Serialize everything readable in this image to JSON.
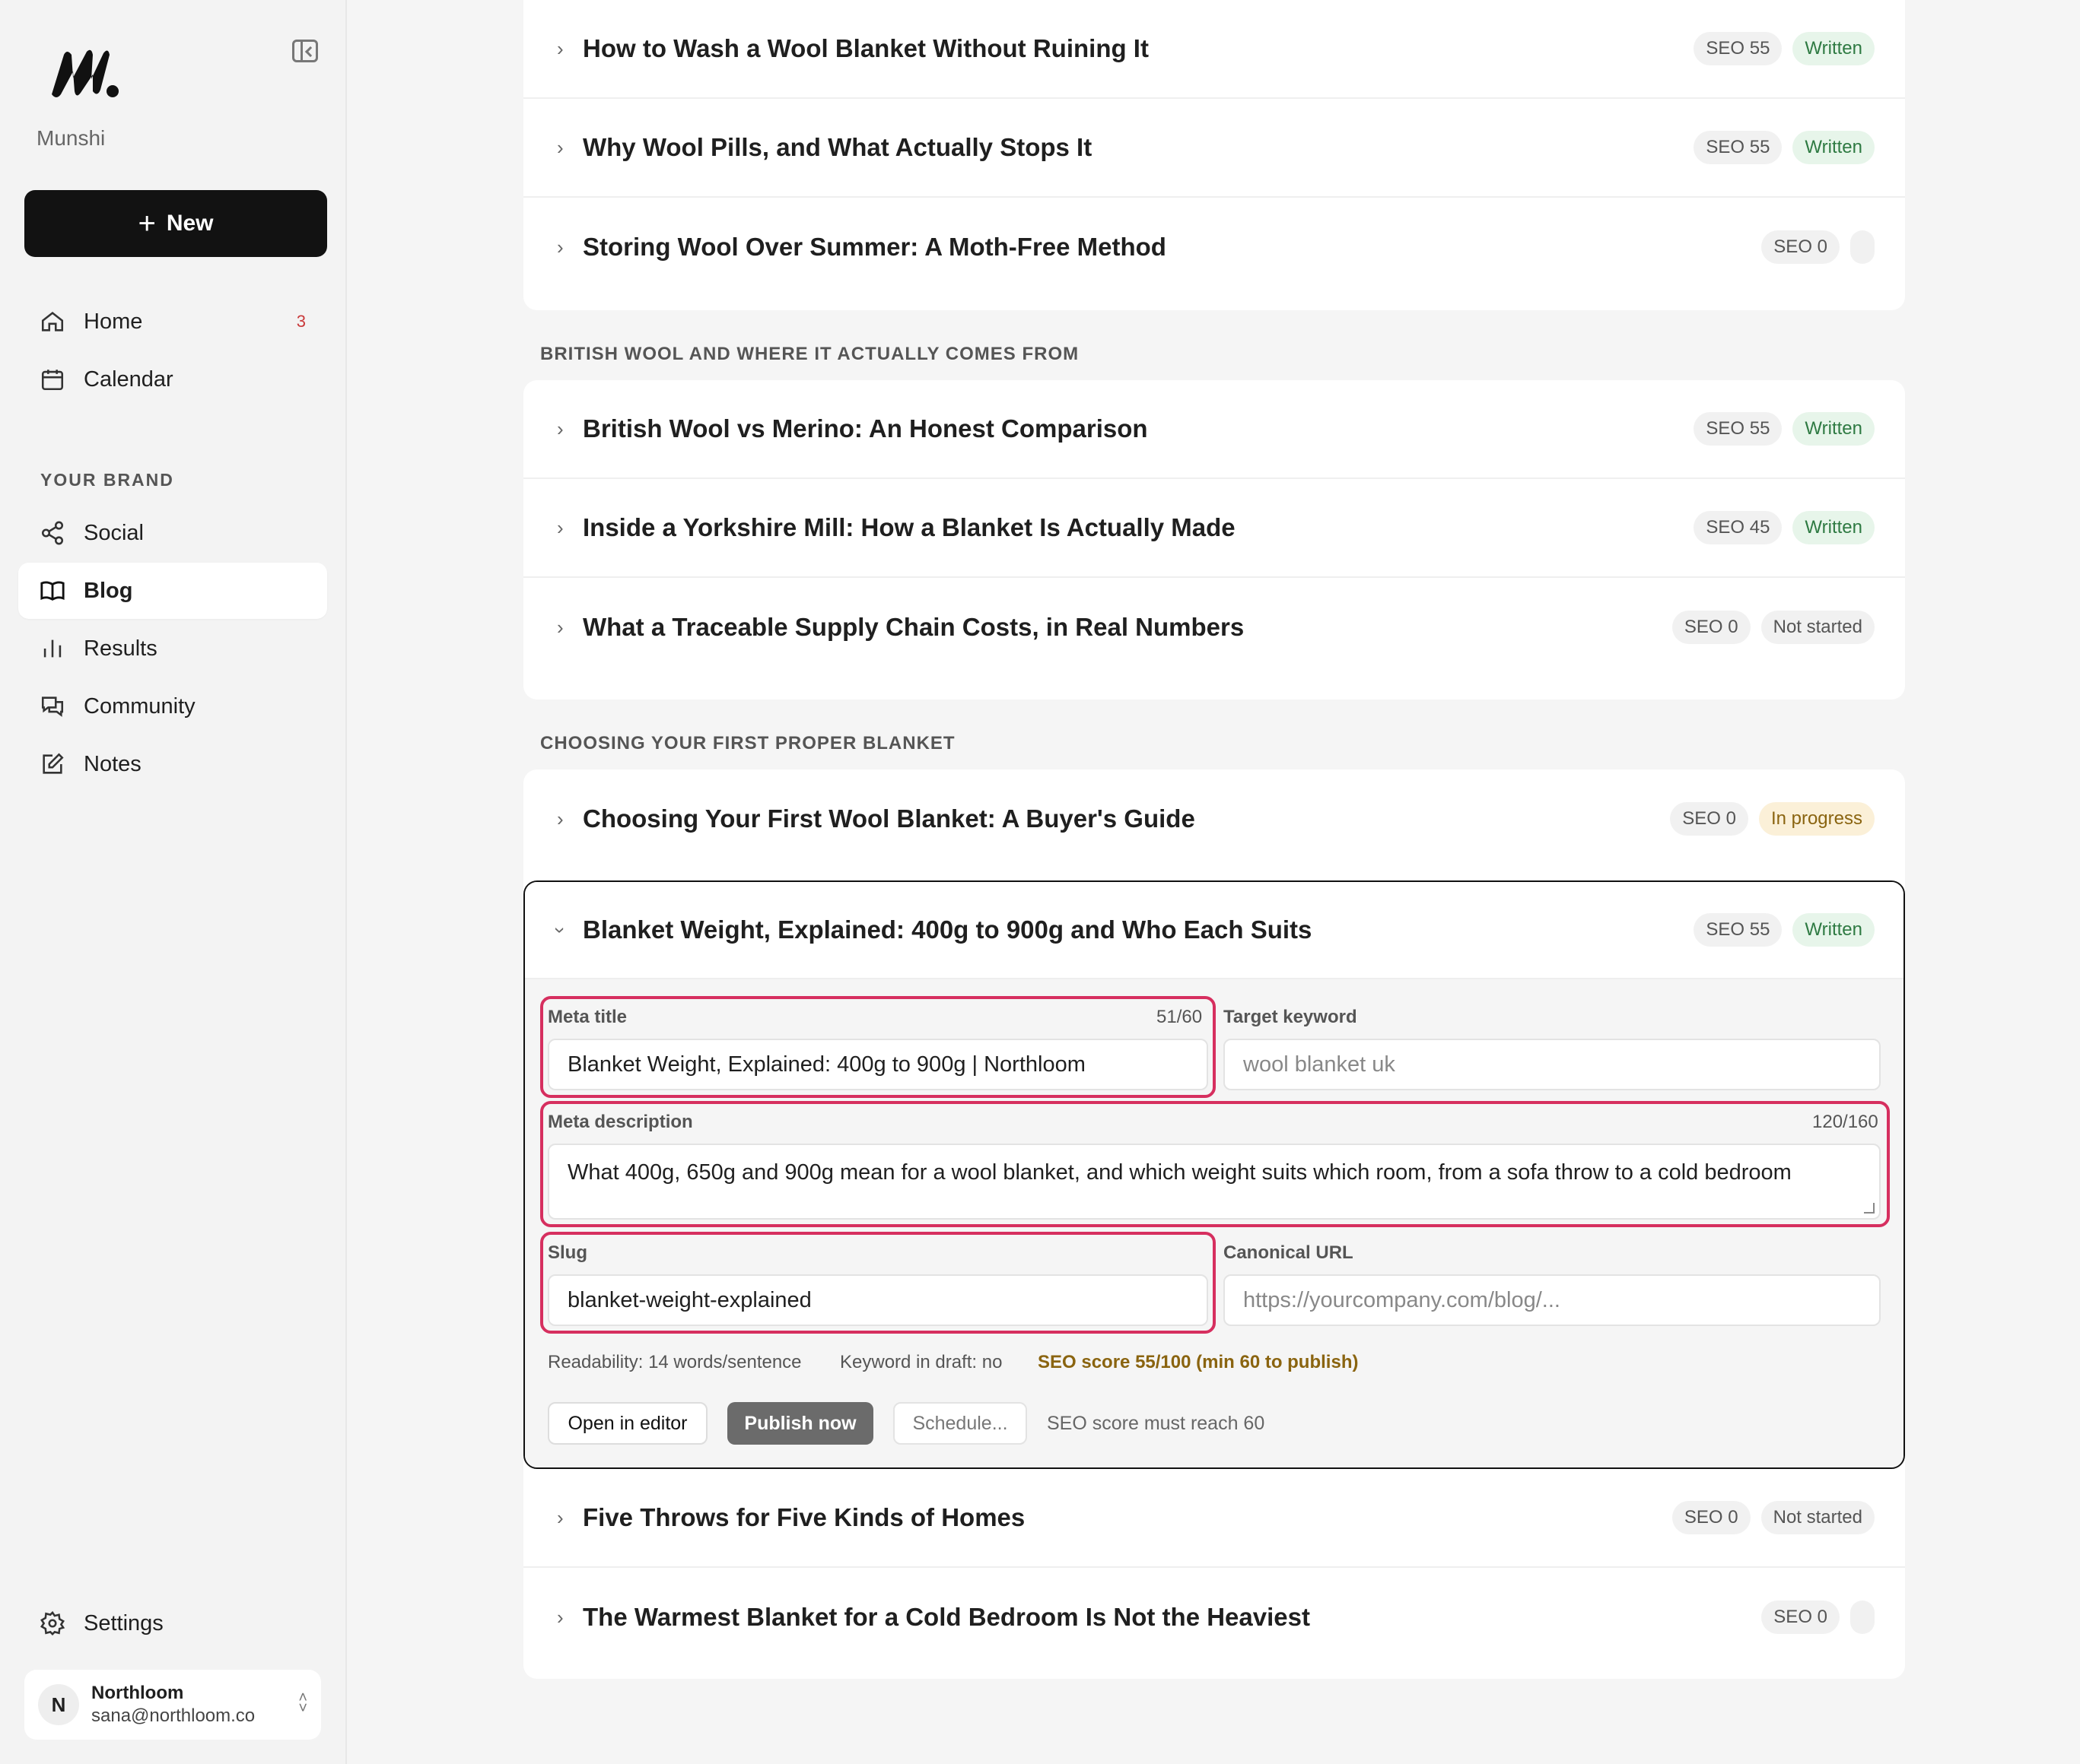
{
  "sidebar": {
    "brand": "Munshi",
    "new_label": "New",
    "nav": [
      {
        "label": "Home",
        "badge": "3"
      },
      {
        "label": "Calendar"
      }
    ],
    "section_label": "YOUR BRAND",
    "brand_nav": [
      {
        "label": "Social"
      },
      {
        "label": "Blog"
      },
      {
        "label": "Results"
      },
      {
        "label": "Community"
      },
      {
        "label": "Notes"
      }
    ],
    "settings_label": "Settings",
    "account": {
      "initial": "N",
      "name": "Northloom",
      "email": "sana@northloom.co"
    }
  },
  "groups": [
    {
      "label": "",
      "posts": [
        {
          "title": "How to Wash a Wool Blanket Without Ruining It",
          "seo": "SEO 55",
          "status": "Written"
        },
        {
          "title": "Why Wool Pills, and What Actually Stops It",
          "seo": "SEO 55",
          "status": "Written"
        },
        {
          "title": "Storing Wool Over Summer: A Moth-Free Method",
          "seo": "SEO 0",
          "status": ""
        }
      ]
    },
    {
      "label": "BRITISH WOOL AND WHERE IT ACTUALLY COMES FROM",
      "posts": [
        {
          "title": "British Wool vs Merino: An Honest Comparison",
          "seo": "SEO 55",
          "status": "Written"
        },
        {
          "title": "Inside a Yorkshire Mill: How a Blanket Is Actually Made",
          "seo": "SEO 45",
          "status": "Written"
        },
        {
          "title": "What a Traceable Supply Chain Costs, in Real Numbers",
          "seo": "SEO 0",
          "status": "Not started"
        }
      ]
    },
    {
      "label": "CHOOSING YOUR FIRST PROPER BLANKET",
      "posts": [
        {
          "title": "Choosing Your First Wool Blanket: A Buyer's Guide",
          "seo": "SEO 0",
          "status": "In progress"
        },
        {
          "title": "Blanket Weight, Explained: 400g to 900g and Who Each Suits",
          "seo": "SEO 55",
          "status": "Written"
        },
        {
          "title": "Five Throws for Five Kinds of Homes",
          "seo": "SEO 0",
          "status": "Not started"
        },
        {
          "title": "The Warmest Blanket for a Cold Bedroom Is Not the Heaviest",
          "seo": "SEO 0",
          "status": ""
        }
      ]
    }
  ],
  "editor": {
    "meta_title_label": "Meta title",
    "meta_title_count": "51/60",
    "meta_title_value": "Blanket Weight, Explained: 400g to 900g | Northloom",
    "target_keyword_label": "Target keyword",
    "target_keyword_placeholder": "wool blanket uk",
    "meta_description_label": "Meta description",
    "meta_description_count": "120/160",
    "meta_description_value": "What 400g, 650g and 900g mean for a wool blanket, and which weight suits which room, from a sofa throw to a cold bedroom",
    "slug_label": "Slug",
    "slug_value": "blanket-weight-explained",
    "canonical_label": "Canonical URL",
    "canonical_placeholder": "https://yourcompany.com/blog/...",
    "readability": "Readability: 14 words/sentence",
    "keyword_in_draft": "Keyword in draft: no",
    "seo_score": "SEO score 55/100 (min 60 to publish)",
    "open_editor": "Open in editor",
    "publish_now": "Publish now",
    "schedule": "Schedule...",
    "publish_hint": "SEO score must reach 60"
  },
  "colors": {
    "highlight": "#d62f5f",
    "written_bg": "#e7f5ea",
    "written_text": "#2e7a42",
    "progress_bg": "#fbf0d8",
    "progress_text": "#8a6410",
    "warn": "#8a6410",
    "badge": "#c9393a"
  }
}
